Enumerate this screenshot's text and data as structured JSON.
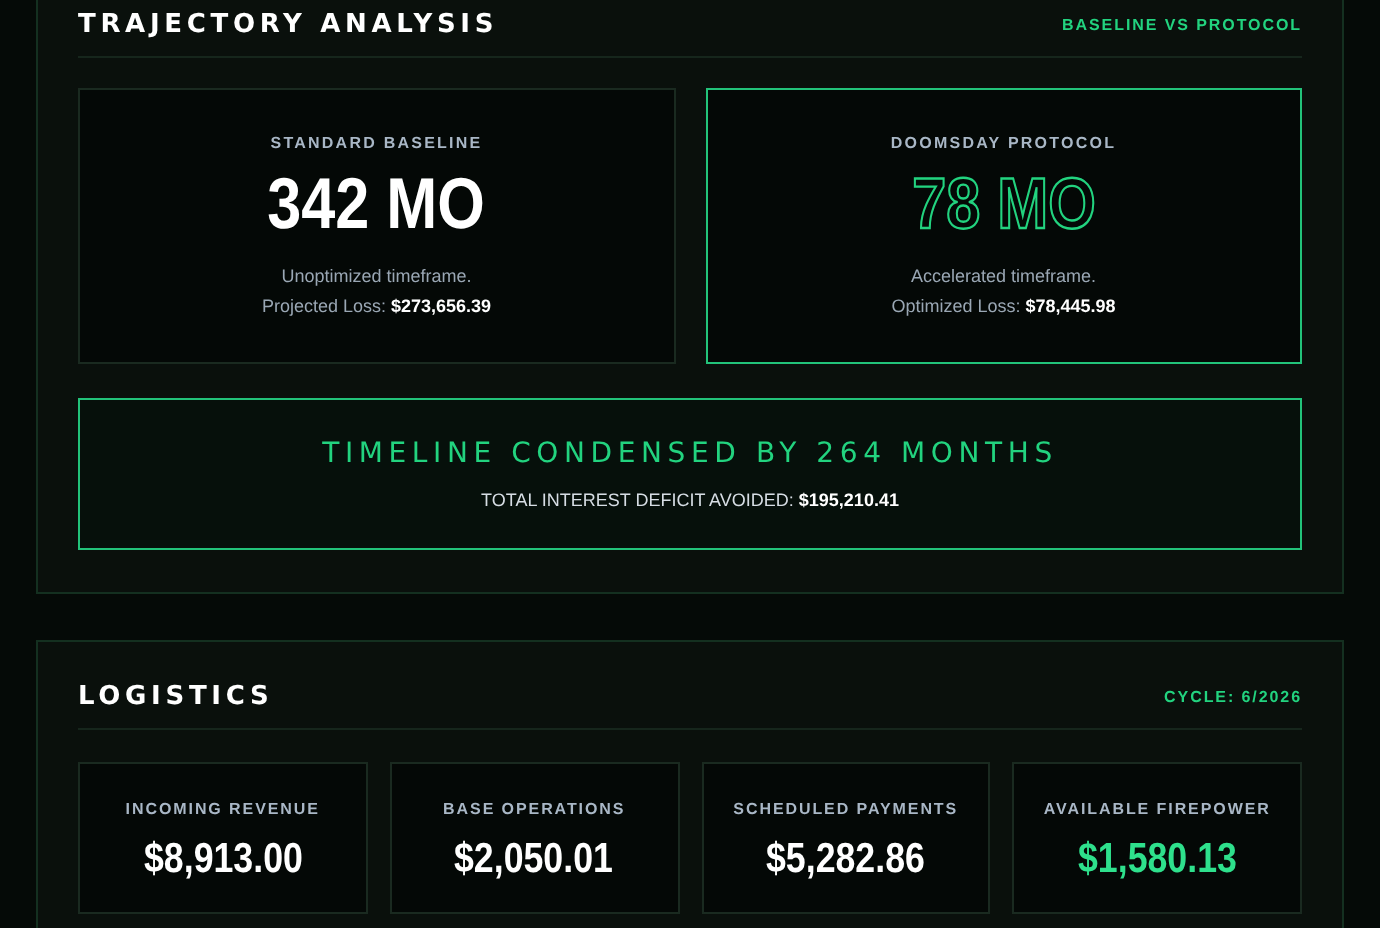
{
  "trajectory": {
    "title": "TRAJECTORY ANALYSIS",
    "tag": "BASELINE VS PROTOCOL",
    "cards": [
      {
        "label": "STANDARD BASELINE",
        "value": "342 MO",
        "note": "Unoptimized timeframe.",
        "loss_label": "Projected Loss:",
        "loss": "$273,656.39",
        "highlighted": false
      },
      {
        "label": "DOOMSDAY PROTOCOL",
        "value": "78 MO",
        "note": "Accelerated timeframe.",
        "loss_label": "Optimized Loss:",
        "loss": "$78,445.98",
        "highlighted": true
      }
    ],
    "summary": {
      "headline": "TIMELINE CONDENSED BY 264 MONTHS",
      "detail_label": "TOTAL INTEREST DEFICIT AVOIDED:",
      "detail_value": "$195,210.41"
    }
  },
  "logistics": {
    "title": "LOGISTICS",
    "tag": "CYCLE: 6/2026",
    "stats": [
      {
        "label": "INCOMING REVENUE",
        "value": "$8,913.00",
        "highlighted": false
      },
      {
        "label": "BASE OPERATIONS",
        "value": "$2,050.01",
        "highlighted": false
      },
      {
        "label": "SCHEDULED PAYMENTS",
        "value": "$5,282.86",
        "highlighted": false
      },
      {
        "label": "AVAILABLE FIREPOWER",
        "value": "$1,580.13",
        "highlighted": true
      }
    ]
  }
}
